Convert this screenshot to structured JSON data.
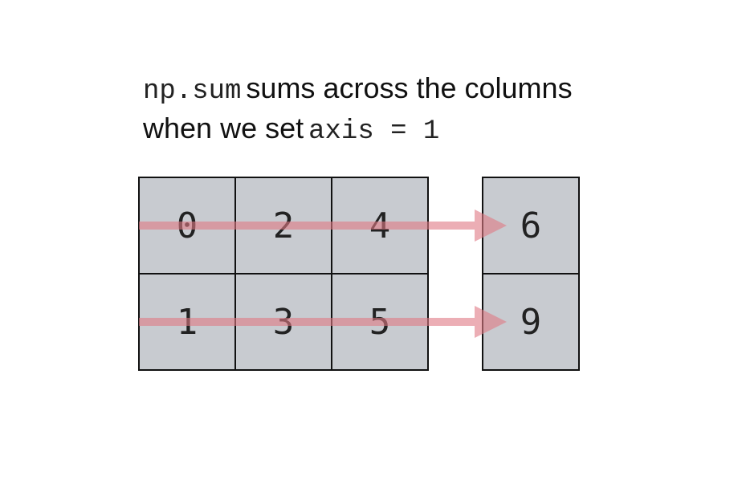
{
  "title": {
    "line1_code": "np.sum",
    "line1_text": "sums across the columns",
    "line2_text": "when we set",
    "line2_code": "axis = 1"
  },
  "colors": {
    "cell_fill": "#c8cbd0",
    "cell_border": "#111111",
    "arrow": "#e07a84"
  },
  "input_array": [
    [
      0,
      2,
      4
    ],
    [
      1,
      3,
      5
    ]
  ],
  "output_array": [
    6,
    9
  ]
}
